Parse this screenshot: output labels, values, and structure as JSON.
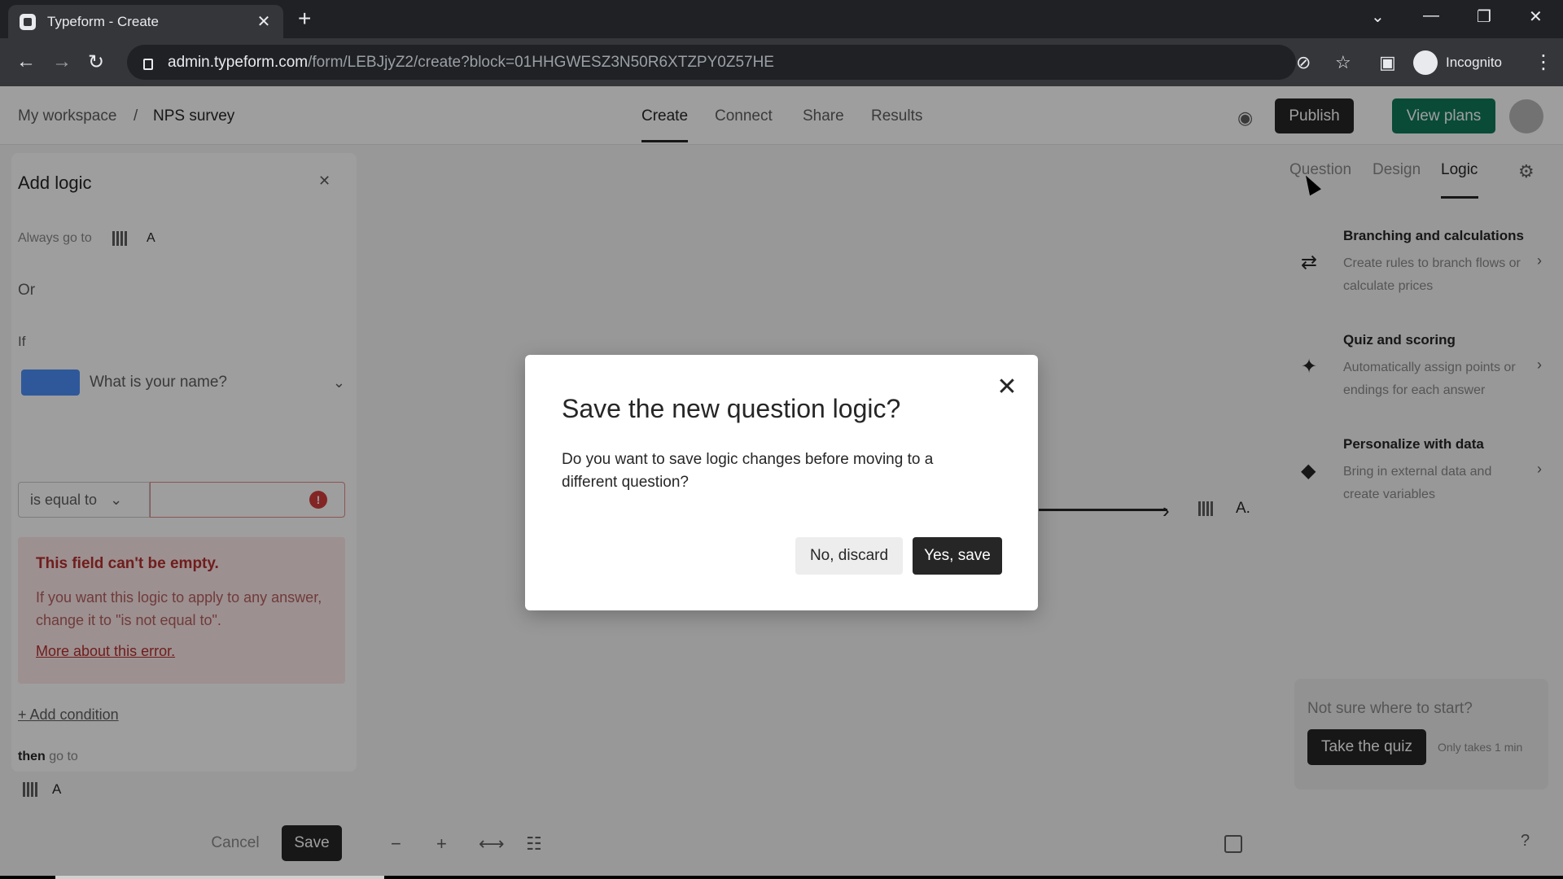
{
  "browser": {
    "tab_title": "Typeform - Create",
    "tab_close": "✕",
    "new_tab": "+",
    "url_host": "admin.typeform.com",
    "url_path": "/form/LEBJjyZ2/create?block=01HHGWESZ3N50R6XTZPY0Z57HE",
    "incognito_label": "Incognito"
  },
  "header": {
    "breadcrumb_workspace": "My workspace",
    "breadcrumb_sep": "/",
    "breadcrumb_form": "NPS survey",
    "tabs": [
      "Create",
      "Connect",
      "Share",
      "Results"
    ],
    "publish": "Publish",
    "view_plans": "View plans"
  },
  "logic_panel": {
    "title": "Add logic",
    "always_go_to": "Always go to",
    "always_target": "A",
    "or": "Or",
    "if": "If",
    "question": "What is your name?",
    "operator": "is equal to",
    "error_title": "This field can't be empty.",
    "error_body": "If you want this logic to apply to any answer, change it to \"is not equal to\".",
    "error_link": "More about this error.",
    "add_condition": "+ Add condition",
    "then_bold": "then",
    "then_rest": " go to",
    "dest_target": "A",
    "cancel": "Cancel",
    "save": "Save"
  },
  "canvas": {
    "node_label": "A."
  },
  "right_panel": {
    "tabs": [
      "Question",
      "Design",
      "Logic"
    ],
    "features": [
      {
        "title": "Branching and calculations",
        "desc": "Create rules to branch flows or calculate prices",
        "icon": "branch-icon"
      },
      {
        "title": "Quiz and scoring",
        "desc": "Automatically assign points or endings for each answer",
        "icon": "sparkle-icon"
      },
      {
        "title": "Personalize with data",
        "desc": "Bring in external data and create variables",
        "icon": "tag-icon"
      }
    ],
    "quiz_prompt": "Not sure where to start?",
    "quiz_button": "Take the quiz",
    "quiz_note": "Only takes 1 min"
  },
  "modal": {
    "title": "Save the new question logic?",
    "body": "Do you want to save logic changes before moving to a different question?",
    "discard": "No, discard",
    "confirm": "Yes, save"
  }
}
